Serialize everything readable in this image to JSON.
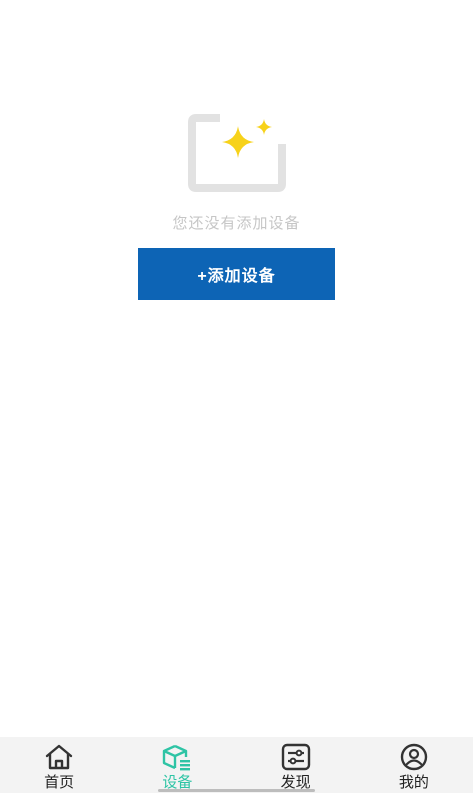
{
  "empty_state": {
    "icon": "empty-box-sparkle-icon",
    "message": "您还没有添加设备",
    "add_button_label": "+添加设备"
  },
  "tabbar": {
    "tabs": [
      {
        "label": "首页",
        "icon": "home-icon",
        "active": false
      },
      {
        "label": "设备",
        "icon": "device-box-icon",
        "active": true
      },
      {
        "label": "发现",
        "icon": "discover-sliders-icon",
        "active": false
      },
      {
        "label": "我的",
        "icon": "user-profile-icon",
        "active": false
      }
    ]
  },
  "colors": {
    "primary_button": "#0d64b5",
    "active_tab": "#2ec4a5",
    "sparkle": "#f7d21a",
    "placeholder_text": "#c6c6c6"
  }
}
